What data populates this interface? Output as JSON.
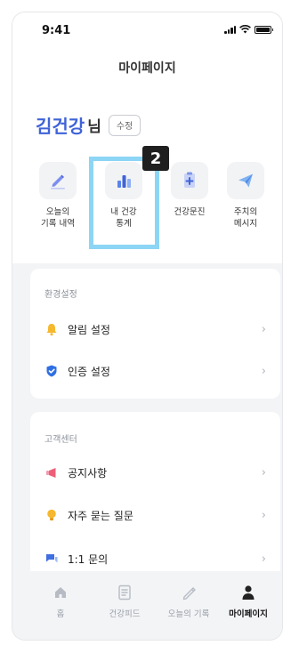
{
  "status": {
    "time": "9:41"
  },
  "header": {
    "title": "마이페이지"
  },
  "user": {
    "name": "김건강",
    "suffix": "님",
    "edit_label": "수정"
  },
  "menu": [
    {
      "label": "오늘의\n기록 내역",
      "icon": "pencil-icon"
    },
    {
      "label": "내 건강\n통계",
      "icon": "bar-chart-icon"
    },
    {
      "label": "건강문진",
      "icon": "clipboard-plus-icon"
    },
    {
      "label": "주치의\n메시지",
      "icon": "paper-plane-icon"
    }
  ],
  "annotation": {
    "badge": "2"
  },
  "settings": {
    "title": "환경설정",
    "items": [
      {
        "label": "알림 설정",
        "icon": "bell-icon"
      },
      {
        "label": "인증 설정",
        "icon": "shield-check-icon"
      }
    ]
  },
  "support": {
    "title": "고객센터",
    "items": [
      {
        "label": "공지사항",
        "icon": "megaphone-icon"
      },
      {
        "label": "자주 묻는 질문",
        "icon": "lightbulb-icon"
      },
      {
        "label": "1:1 문의",
        "icon": "chat-icon"
      }
    ]
  },
  "nav": [
    {
      "label": "홈",
      "icon": "home-icon",
      "active": false
    },
    {
      "label": "건강피드",
      "icon": "feed-icon",
      "active": false
    },
    {
      "label": "오늘의 기록",
      "icon": "pencil-outline-icon",
      "active": false
    },
    {
      "label": "마이페이지",
      "icon": "person-icon",
      "active": true
    }
  ],
  "colors": {
    "accent": "#3f63d8",
    "highlight": "#8cd5f5"
  }
}
